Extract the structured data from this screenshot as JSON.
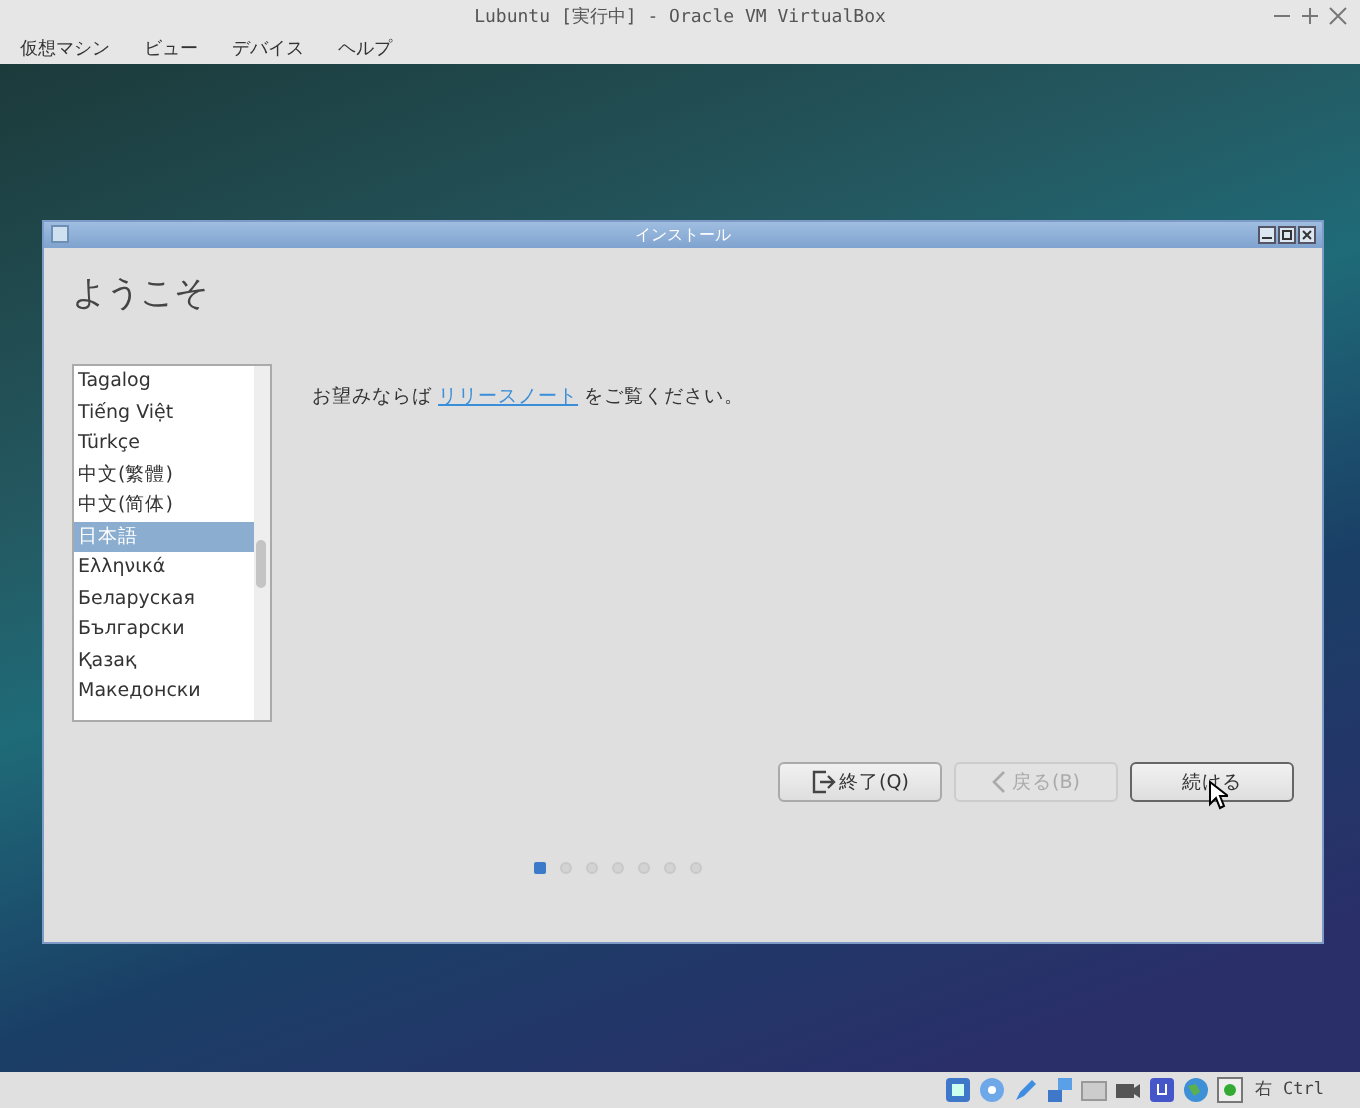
{
  "window": {
    "title": "Lubuntu [実行中] - Oracle VM VirtualBox"
  },
  "menu": [
    "仮想マシン",
    "ビュー",
    "デバイス",
    "ヘルプ"
  ],
  "installer": {
    "title": "インストール",
    "heading": "ようこそ",
    "languages": [
      {
        "label": "Tagalog",
        "selected": false
      },
      {
        "label": "Tiếng Việt",
        "selected": false
      },
      {
        "label": "Türkçe",
        "selected": false
      },
      {
        "label": "中文(繁體)",
        "selected": false
      },
      {
        "label": "中文(简体)",
        "selected": false
      },
      {
        "label": "日本語",
        "selected": true
      },
      {
        "label": "Ελληνικά",
        "selected": false
      },
      {
        "label": "Беларуская",
        "selected": false
      },
      {
        "label": "Български",
        "selected": false
      },
      {
        "label": "Қазақ",
        "selected": false
      },
      {
        "label": "Македонски",
        "selected": false
      }
    ],
    "notes": {
      "before": "お望みならば",
      "link": "リリースノート",
      "after": "をご覧ください。"
    },
    "buttons": [
      {
        "label": "終了(Q)",
        "kind": "quit",
        "disabled": false
      },
      {
        "label": "戻る(B)",
        "kind": "back",
        "disabled": true
      },
      {
        "label": "続ける",
        "kind": "continue",
        "disabled": false
      }
    ],
    "steps": [
      {
        "selected": true
      },
      {
        "selected": false
      },
      {
        "selected": false
      },
      {
        "selected": false
      },
      {
        "selected": false
      },
      {
        "selected": false
      },
      {
        "selected": false
      }
    ]
  },
  "status_bar": {
    "host_key": "右 Ctrl"
  }
}
